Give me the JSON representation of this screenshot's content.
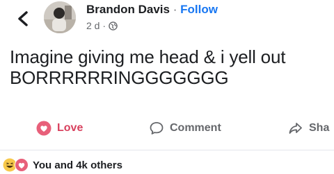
{
  "header": {
    "back_icon": "chevron-left-icon",
    "author": "Brandon Davis",
    "separator": "·",
    "follow_label": "Follow",
    "timestamp": "2 d ·",
    "privacy_icon": "globe-icon"
  },
  "post": {
    "line1": "Imagine giving me head & i yell out",
    "line2": "BORRRRRRINGGGGGGG"
  },
  "actions": {
    "love_label": "Love",
    "comment_label": "Comment",
    "share_label": "Sha"
  },
  "reactions": {
    "icons": [
      "haha-icon",
      "love-icon"
    ],
    "summary": "You and 4k others"
  },
  "colors": {
    "love": "#d8415e",
    "follow": "#1877f2",
    "muted": "#65676b"
  }
}
